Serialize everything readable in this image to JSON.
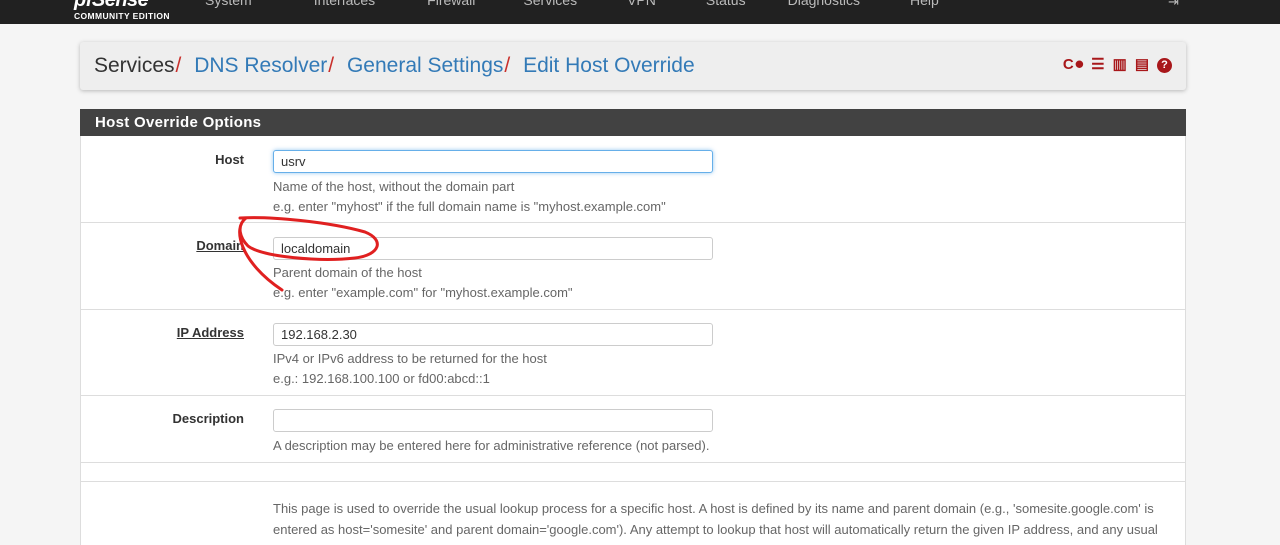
{
  "brand": {
    "name": "pfSense",
    "edition": "COMMUNITY EDITION"
  },
  "nav": [
    "System",
    "Interfaces",
    "Firewall",
    "Services",
    "VPN",
    "Status",
    "Diagnostics",
    "Help"
  ],
  "nav_logout_icon": "logout-icon",
  "breadcrumb": {
    "home": "Services",
    "sep": "/",
    "items": [
      "DNS Resolver",
      "General Settings",
      "Edit Host Override"
    ]
  },
  "toolbar_icons": [
    "restart-service-icon",
    "stop-service-icon",
    "settings-sliders-icon",
    "status-chart-icon",
    "log-icon",
    "help-icon"
  ],
  "toolbar_glyphs": [
    "C",
    "⏺",
    "☰",
    "▥",
    "▤",
    "?"
  ],
  "panel": {
    "title": "Host Override Options"
  },
  "form": {
    "host": {
      "label": "Host",
      "value": "usrv",
      "help1": "Name of the host, without the domain part",
      "help2": "e.g. enter \"myhost\" if the full domain name is \"myhost.example.com\""
    },
    "domain": {
      "label": "Domain",
      "value": "localdomain",
      "help1": "Parent domain of the host",
      "help2": "e.g. enter \"example.com\" for \"myhost.example.com\""
    },
    "ip": {
      "label": "IP Address",
      "value": "192.168.2.30",
      "help1": "IPv4 or IPv6 address to be returned for the host",
      "help2": "e.g.: 192.168.100.100 or fd00:abcd::1"
    },
    "description": {
      "label": "Description",
      "value": "",
      "help1": "A description may be entered here for administrative reference (not parsed)."
    }
  },
  "info_text": "This page is used to override the usual lookup process for a specific host. A host is defined by its name and parent domain (e.g., 'somesite.google.com' is entered as host='somesite' and parent domain='google.com'). Any attempt to lookup that host will automatically return the given IP address, and any usual external lookup server for the domain will not be queried. Both the name and parent domain can contain 'non-standard', 'invalid' and 'local' domains",
  "colors": {
    "navbar": "#212121",
    "link": "#337ab7",
    "accent_red": "#a8171a",
    "panel_heading": "#424242",
    "annotation": "#e02020"
  }
}
